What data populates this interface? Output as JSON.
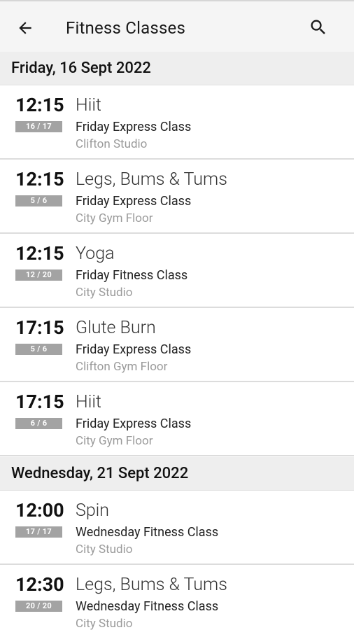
{
  "appbar": {
    "title": "Fitness Classes",
    "back_icon": "arrow-left-icon",
    "search_icon": "search-icon"
  },
  "sections": [
    {
      "date": "Friday, 16 Sept 2022",
      "classes": [
        {
          "time": "12:15",
          "spaces": "16 / 17",
          "name": "Hiit",
          "type": "Friday Express Class",
          "location": "Clifton Studio"
        },
        {
          "time": "12:15",
          "spaces": "5 / 6",
          "name": "Legs, Bums & Tums",
          "type": "Friday Express Class",
          "location": "City Gym Floor"
        },
        {
          "time": "12:15",
          "spaces": "12 / 20",
          "name": "Yoga",
          "type": "Friday Fitness Class",
          "location": "City Studio"
        },
        {
          "time": "17:15",
          "spaces": "5 / 6",
          "name": "Glute Burn",
          "type": "Friday Express Class",
          "location": "Clifton Gym Floor"
        },
        {
          "time": "17:15",
          "spaces": "6 / 6",
          "name": "Hiit",
          "type": "Friday Express Class",
          "location": "City Gym Floor"
        }
      ]
    },
    {
      "date": "Wednesday, 21 Sept 2022",
      "classes": [
        {
          "time": "12:00",
          "spaces": "17 / 17",
          "name": "Spin",
          "type": "Wednesday Fitness Class",
          "location": "City Studio"
        },
        {
          "time": "12:30",
          "spaces": "20 / 20",
          "name": "Legs, Bums & Tums",
          "type": "Wednesday Fitness Class",
          "location": "City Studio"
        }
      ]
    }
  ],
  "colors": {
    "appbar_bg": "#f5f5f5",
    "section_bg": "#eeeeee",
    "badge_bg": "#a3a3a3",
    "location_text": "#9a9a9a"
  }
}
